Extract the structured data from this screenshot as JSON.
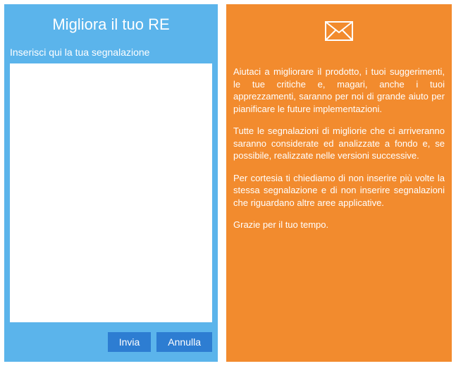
{
  "left": {
    "title": "Migliora il tuo RE",
    "label": "Inserisci qui la tua segnalazione",
    "textarea_value": "",
    "buttons": {
      "submit": "Invia",
      "cancel": "Annulla"
    }
  },
  "right": {
    "icon": "envelope-icon",
    "paragraphs": [
      "Aiutaci a migliorare il prodotto, i tuoi suggerimenti, le tue critiche e, magari, anche i tuoi apprezzamenti, saranno per noi di grande aiuto per pianificare le future implementazioni.",
      "Tutte le segnalazioni di migliorie che ci arriveranno saranno considerate ed analizzate a fondo e, se possibile, realizzate nelle versioni successive.",
      "Per cortesia ti chiediamo di non inserire più volte la stessa segnalazione e di non inserire segnalazioni che riguardano altre aree applicative.",
      "Grazie per il tuo tempo."
    ]
  },
  "colors": {
    "left_bg": "#5bb4eb",
    "right_bg": "#f28b2e",
    "button_bg": "#2d7dd2"
  }
}
